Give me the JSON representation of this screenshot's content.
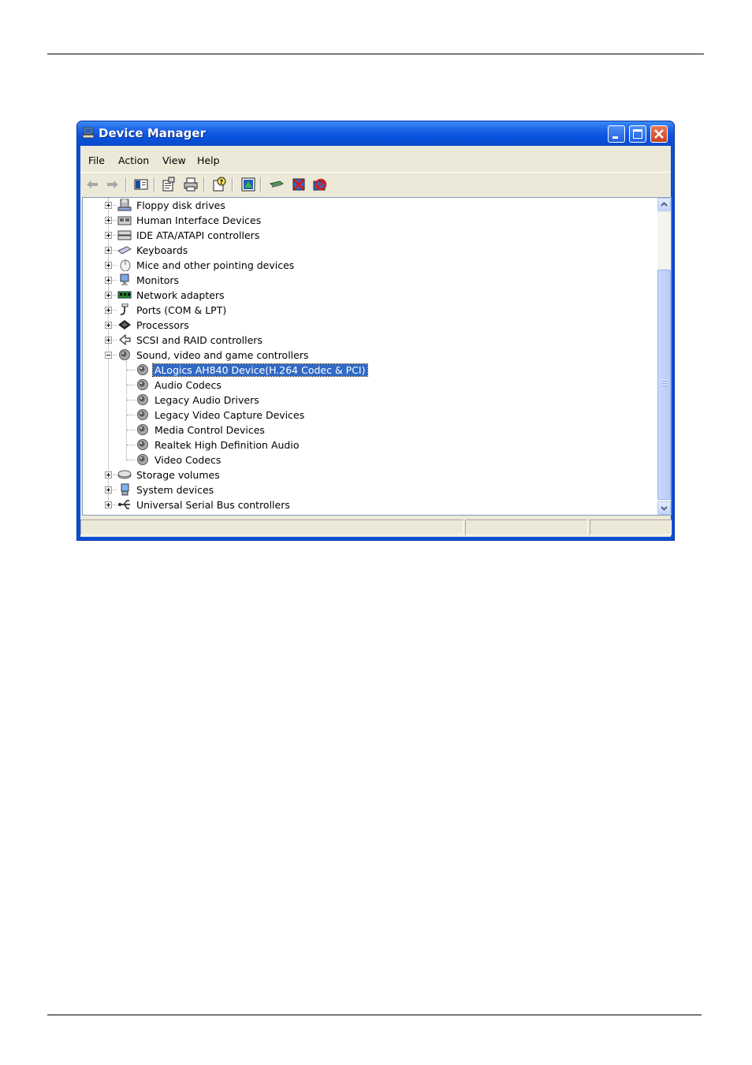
{
  "window": {
    "title": "Device Manager"
  },
  "menu": [
    "File",
    "Action",
    "View",
    "Help"
  ],
  "toolbar_icons": [
    "back-icon",
    "forward-icon",
    "show-hide-tree-icon",
    "properties-icon",
    "print-icon",
    "help-icon",
    "update-driver-icon",
    "scan-hardware-icon",
    "uninstall-icon",
    "disable-icon"
  ],
  "tree": {
    "items": [
      {
        "label": "Floppy disk drives",
        "icon": "floppy-drive-icon",
        "state": "collapsed"
      },
      {
        "label": "Human Interface Devices",
        "icon": "hid-icon",
        "state": "collapsed"
      },
      {
        "label": "IDE ATA/ATAPI controllers",
        "icon": "ide-controller-icon",
        "state": "collapsed"
      },
      {
        "label": "Keyboards",
        "icon": "keyboard-icon",
        "state": "collapsed"
      },
      {
        "label": "Mice and other pointing devices",
        "icon": "mouse-icon",
        "state": "collapsed"
      },
      {
        "label": "Monitors",
        "icon": "monitor-icon",
        "state": "collapsed"
      },
      {
        "label": "Network adapters",
        "icon": "network-adapter-icon",
        "state": "collapsed"
      },
      {
        "label": "Ports (COM & LPT)",
        "icon": "port-icon",
        "state": "collapsed"
      },
      {
        "label": "Processors",
        "icon": "processor-icon",
        "state": "collapsed"
      },
      {
        "label": "SCSI and RAID controllers",
        "icon": "scsi-icon",
        "state": "collapsed"
      },
      {
        "label": "Sound, video and game controllers",
        "icon": "speaker-icon",
        "state": "expanded"
      },
      {
        "label": "ALogics AH840 Device(H.264 Codec & PCI)",
        "icon": "speaker-icon",
        "child": true,
        "selected": true
      },
      {
        "label": "Audio Codecs",
        "icon": "speaker-icon",
        "child": true
      },
      {
        "label": "Legacy Audio Drivers",
        "icon": "speaker-icon",
        "child": true
      },
      {
        "label": "Legacy Video Capture Devices",
        "icon": "speaker-icon",
        "child": true
      },
      {
        "label": "Media Control Devices",
        "icon": "speaker-icon",
        "child": true
      },
      {
        "label": "Realtek High Definition Audio",
        "icon": "speaker-icon",
        "child": true
      },
      {
        "label": "Video Codecs",
        "icon": "speaker-icon",
        "child": true
      },
      {
        "label": "Storage volumes",
        "icon": "storage-volume-icon",
        "state": "collapsed"
      },
      {
        "label": "System devices",
        "icon": "system-device-icon",
        "state": "collapsed"
      },
      {
        "label": "Universal Serial Bus controllers",
        "icon": "usb-icon",
        "state": "collapsed"
      }
    ]
  },
  "colors": {
    "titlebar": "#0a52dd",
    "selection": "#316ac5",
    "face": "#ece9d8"
  }
}
